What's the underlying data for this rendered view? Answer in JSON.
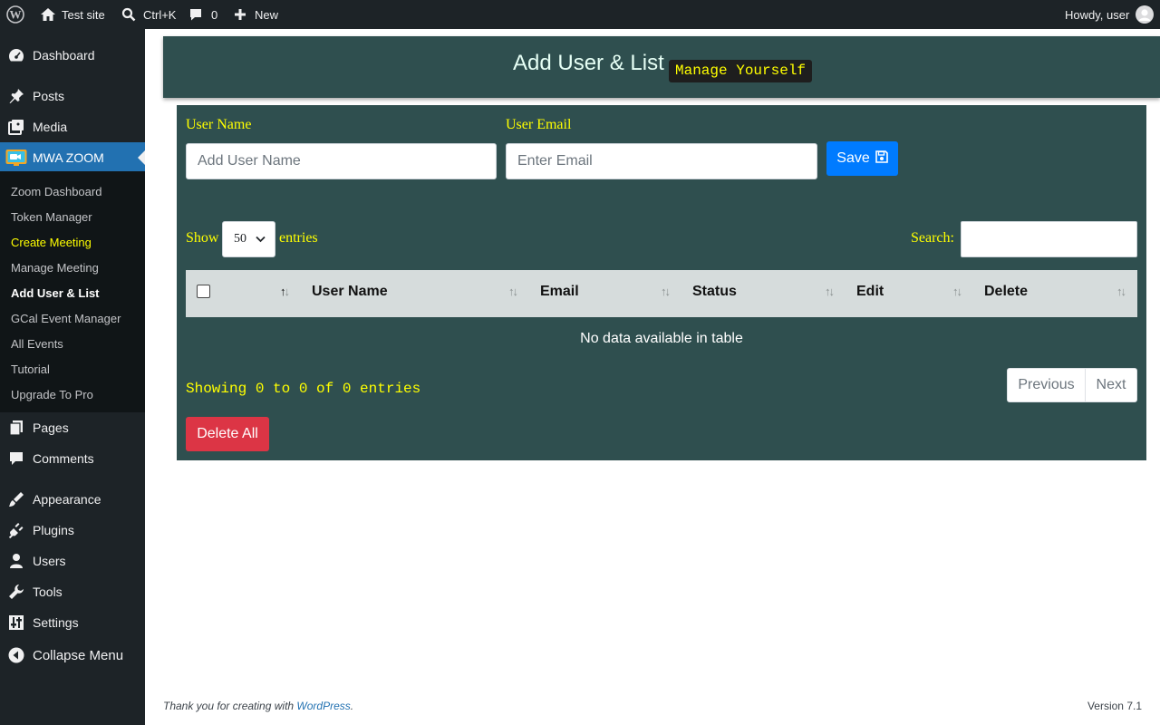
{
  "adminbar": {
    "site_name": "Test site",
    "search_shortcut": "Ctrl+K",
    "comment_count": "0",
    "new_label": "New",
    "howdy": "Howdy, user"
  },
  "sidebar": {
    "items": [
      {
        "label": "Dashboard",
        "icon": "dashboard-icon"
      },
      {
        "label": "Posts",
        "icon": "pin-icon"
      },
      {
        "label": "Media",
        "icon": "media-icon"
      },
      {
        "label": "MWA ZOOM",
        "icon": "zoom-plugin-icon"
      },
      {
        "label": "Pages",
        "icon": "pages-icon"
      },
      {
        "label": "Comments",
        "icon": "comment-icon"
      },
      {
        "label": "Appearance",
        "icon": "brush-icon"
      },
      {
        "label": "Plugins",
        "icon": "plug-icon"
      },
      {
        "label": "Users",
        "icon": "user-icon"
      },
      {
        "label": "Tools",
        "icon": "wrench-icon"
      },
      {
        "label": "Settings",
        "icon": "sliders-icon"
      },
      {
        "label": "Collapse Menu",
        "icon": "collapse-icon"
      }
    ],
    "submenu": [
      "Zoom Dashboard",
      "Token Manager",
      "Create Meeting",
      "Manage Meeting",
      "Add User & List",
      "GCal Event Manager",
      "All Events",
      "Tutorial",
      "Upgrade To Pro"
    ]
  },
  "header": {
    "title": "Add User & List",
    "badge": "Manage Yourself"
  },
  "form": {
    "user_name_label": "User Name",
    "user_name_placeholder": "Add User Name",
    "user_email_label": "User Email",
    "user_email_placeholder": "Enter Email",
    "save_label": "Save"
  },
  "table": {
    "show_label": "Show",
    "entries_label": "entries",
    "page_length": "50",
    "search_label": "Search:",
    "columns": [
      "User Name",
      "Email",
      "Status",
      "Edit",
      "Delete"
    ],
    "empty_message": "No data available in table",
    "info": "Showing 0 to 0 of 0 entries",
    "previous_label": "Previous",
    "next_label": "Next",
    "delete_all_label": "Delete All"
  },
  "footer": {
    "thanks_prefix": "Thank you for creating with ",
    "thanks_link": "WordPress",
    "thanks_suffix": ".",
    "version": "Version 7.1"
  },
  "colors": {
    "panel": "#2f4f4f",
    "label_yellow": "#ffff00",
    "save_blue": "#007bff",
    "delete_red": "#dc3545",
    "sidebar_active": "#2271b1"
  }
}
